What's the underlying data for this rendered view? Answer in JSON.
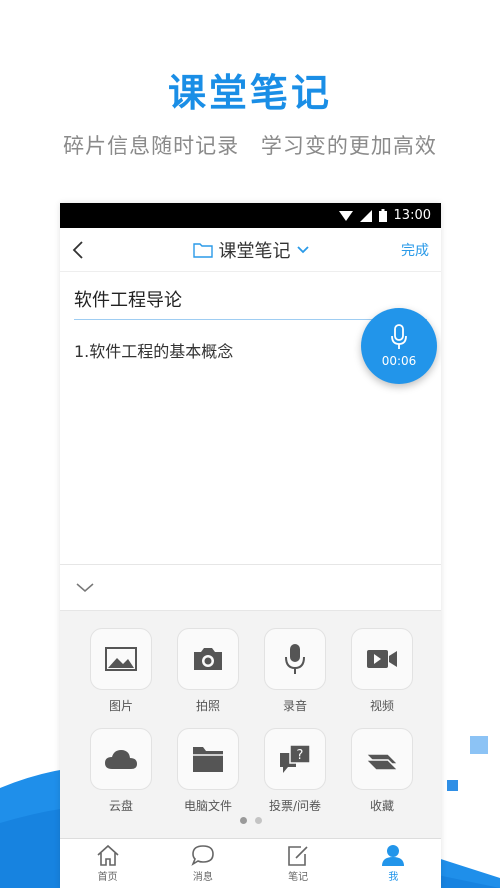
{
  "hero": {
    "title": "课堂笔记",
    "subtitle": "碎片信息随时记录 学习变的更加高效"
  },
  "status_bar": {
    "time": "13:00"
  },
  "nav": {
    "folder_title": "课堂笔记",
    "done_label": "完成",
    "back_icon": "chevron-left-icon"
  },
  "note": {
    "title": "软件工程导论",
    "body": "1.软件工程的基本概念"
  },
  "recorder": {
    "elapsed": "00:06",
    "icon": "microphone-icon"
  },
  "tools": [
    {
      "label": "图片",
      "icon": "image-icon"
    },
    {
      "label": "拍照",
      "icon": "camera-icon"
    },
    {
      "label": "录音",
      "icon": "microphone-icon"
    },
    {
      "label": "视频",
      "icon": "video-icon"
    },
    {
      "label": "云盘",
      "icon": "cloud-icon"
    },
    {
      "label": "电脑文件",
      "icon": "folder-icon"
    },
    {
      "label": "投票/问卷",
      "icon": "vote-icon"
    },
    {
      "label": "收藏",
      "icon": "collection-icon"
    }
  ],
  "pager": {
    "pages": 2,
    "current": 1
  },
  "tabs": [
    {
      "label": "首页",
      "icon": "home-icon",
      "active": false
    },
    {
      "label": "消息",
      "icon": "message-icon",
      "active": false
    },
    {
      "label": "笔记",
      "icon": "note-icon",
      "active": false
    },
    {
      "label": "我",
      "icon": "profile-icon",
      "active": true
    }
  ],
  "colors": {
    "accent": "#2295ea",
    "title_blue": "#1a8ee6",
    "subtitle_gray": "#8a8a8a",
    "panel_bg": "#f3f3f3"
  }
}
